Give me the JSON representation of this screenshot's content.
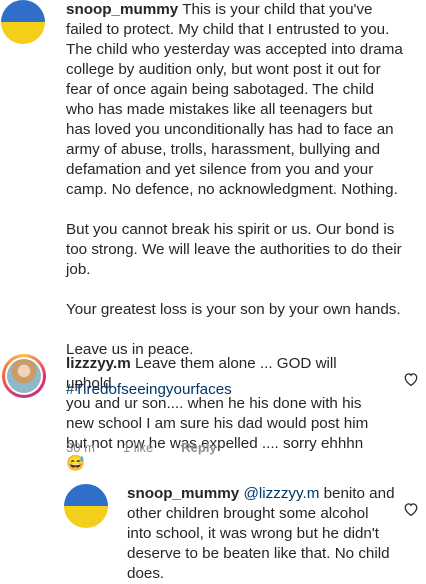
{
  "colors": {
    "flag_blue": "#2f6fc9",
    "flag_yellow": "#f3cf1a",
    "link": "#00376b",
    "meta": "#8e8e8e"
  },
  "comment1": {
    "username": "snoop_mummy",
    "line1": " This is your child that you've",
    "lines": [
      "failed to protect. My child that I entrusted to you.",
      "The child who yesterday was accepted into drama",
      "college by audition only, but wont post it out for",
      "fear of once again being sabotaged. The child",
      "who has made mistakes like all teenagers but",
      "has loved you unconditionally has had to face an",
      "army of abuse, trolls, harassment, bullying and",
      "defamation and yet silence from you and your",
      "camp. No defence, no acknowledgment. Nothing."
    ],
    "para2": [
      "But you cannot break his spirit or us. Our bond is",
      "too strong. We will leave the authorities to do their",
      "job."
    ],
    "para3": "Your greatest loss is your son by your own hands.",
    "para4": "Leave us in peace.",
    "hashtag": "#Tiredofseeingyourfaces"
  },
  "comment2": {
    "username": "lizzzyy.m",
    "line1": " Leave them alone ... GOD will uphold",
    "lines": [
      "you and ur son.... when he his done with his",
      "new school I am sure his dad would post him",
      "but not now he was expelled .... sorry ehhhn😅"
    ],
    "time": "30 m",
    "likes": "1 like",
    "reply": "Reply"
  },
  "comment3": {
    "username": "snoop_mummy",
    "mention": " @lizzzyy.m",
    "line1_rest": " benito and",
    "lines": [
      "other children brought some alcohol",
      "into school, it was wrong but he didn't",
      "deserve to be beaten like that. No child",
      "does."
    ]
  }
}
